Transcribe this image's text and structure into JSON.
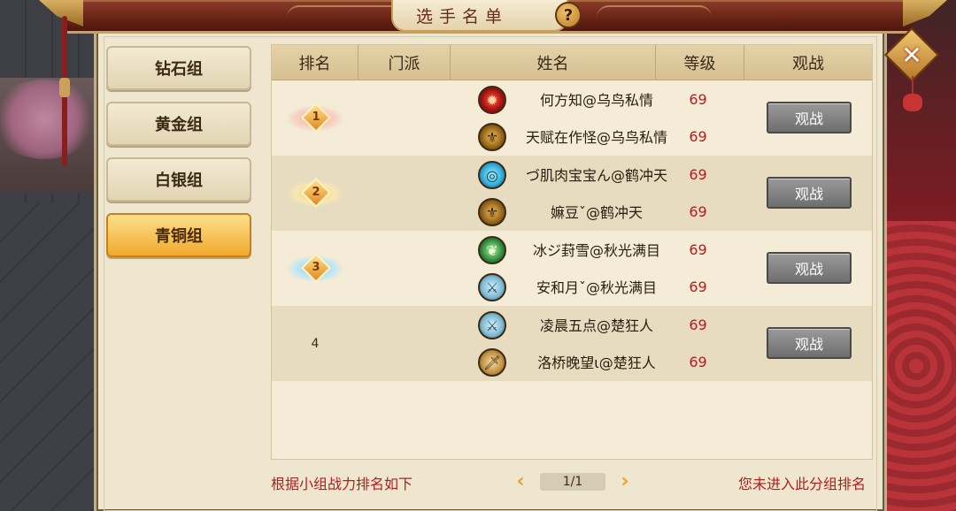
{
  "title": "选手名单",
  "groups": [
    "钻石组",
    "黄金组",
    "白银组",
    "青铜组"
  ],
  "active_group": "青铜组",
  "table": {
    "headers": {
      "rank": "排名",
      "school": "门派",
      "name": "姓名",
      "level": "等级",
      "watch": "观战"
    },
    "rows": [
      {
        "rank": "1",
        "members": [
          {
            "school_icon": "fire-emblem-icon",
            "name": "何方知@乌鸟私情",
            "level": "69"
          },
          {
            "school_icon": "gold-fleur-icon",
            "name": "天赋在作怪@乌鸟私情",
            "level": "69"
          }
        ],
        "watch_label": "观战"
      },
      {
        "rank": "2",
        "members": [
          {
            "school_icon": "blue-ring-icon",
            "name": "づ肌肉宝宝ん@鹤冲天",
            "level": "69"
          },
          {
            "school_icon": "gold-fleur-icon",
            "name": "嫲豆ˇ@鹤冲天",
            "level": "69"
          }
        ],
        "watch_label": "观战"
      },
      {
        "rank": "3",
        "members": [
          {
            "school_icon": "green-mask-icon",
            "name": "冰ジ葑雪@秋光满目",
            "level": "69"
          },
          {
            "school_icon": "crossed-swords-icon",
            "name": "安和月ˇ@秋光满目",
            "level": "69"
          }
        ],
        "watch_label": "观战"
      },
      {
        "rank": "4",
        "members": [
          {
            "school_icon": "crossed-swords-icon",
            "name": "凌晨五点@楚狂人",
            "level": "69"
          },
          {
            "school_icon": "blade-icon",
            "name": "洛桥晚望ι@楚狂人",
            "level": "69"
          }
        ],
        "watch_label": "观战"
      }
    ]
  },
  "footer": {
    "note_left": "根据小组战力排名如下",
    "page": "1/1",
    "note_right": "您未进入此分组排名"
  },
  "help_label": "?",
  "close_label": "✕",
  "colors": {
    "level_red": "#b01f1f",
    "active_tab": "#f0aa2e",
    "button_gray": "#7a7a7a"
  }
}
